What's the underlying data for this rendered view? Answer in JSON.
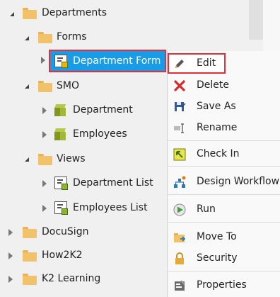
{
  "tree": {
    "items": [
      {
        "label": "Departments",
        "icon": "folder-icon",
        "state": "expanded"
      },
      {
        "label": "Forms",
        "icon": "folder-icon",
        "state": "expanded"
      },
      {
        "label": "Department Form",
        "icon": "form-icon",
        "state": "collapsed",
        "selected": true
      },
      {
        "label": "SMO",
        "icon": "folder-icon",
        "state": "expanded"
      },
      {
        "label": "Department",
        "icon": "smartobject-icon",
        "state": "collapsed"
      },
      {
        "label": "Employees",
        "icon": "smartobject-icon",
        "state": "collapsed"
      },
      {
        "label": "Views",
        "icon": "folder-icon",
        "state": "expanded"
      },
      {
        "label": "Department List",
        "icon": "list-view-icon",
        "state": "collapsed"
      },
      {
        "label": "Employees List",
        "icon": "list-view-icon",
        "state": "collapsed"
      },
      {
        "label": "DocuSign",
        "icon": "folder-icon",
        "state": "collapsed"
      },
      {
        "label": "How2K2",
        "icon": "folder-icon",
        "state": "collapsed"
      },
      {
        "label": "K2 Learning",
        "icon": "folder-icon",
        "state": "collapsed"
      }
    ]
  },
  "context_menu": {
    "items": [
      {
        "label": "Edit",
        "icon": "pencil-icon",
        "highlighted": true
      },
      {
        "label": "Delete",
        "icon": "delete-x-icon"
      },
      {
        "label": "Save As",
        "icon": "save-as-icon"
      },
      {
        "label": "Rename",
        "icon": "rename-icon"
      },
      {
        "label": "Check In",
        "icon": "check-in-icon"
      },
      {
        "label": "Design Workflow",
        "icon": "workflow-icon"
      },
      {
        "label": "Run",
        "icon": "run-icon"
      },
      {
        "label": "Move To",
        "icon": "move-to-icon"
      },
      {
        "label": "Security",
        "icon": "lock-icon"
      },
      {
        "label": "Properties",
        "icon": "properties-icon"
      }
    ]
  },
  "colors": {
    "selection": "#1a9be6",
    "highlight_outline": "#e0303a",
    "folder": "#f2c26a"
  }
}
